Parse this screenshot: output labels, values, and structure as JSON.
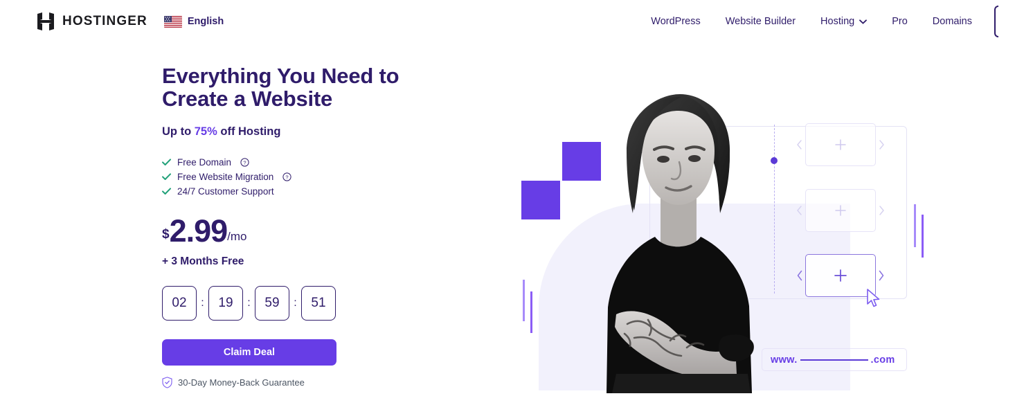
{
  "header": {
    "brand_name": "HOSTINGER",
    "logo_icon": "hostinger-h-logo",
    "language": {
      "label": "English",
      "flag_icon": "us-flag-icon"
    },
    "nav": [
      {
        "label": "WordPress",
        "has_chevron": false
      },
      {
        "label": "Website Builder",
        "has_chevron": false
      },
      {
        "label": "Hosting",
        "has_chevron": true
      },
      {
        "label": "Pro",
        "has_chevron": false
      },
      {
        "label": "Domains",
        "has_chevron": false
      }
    ]
  },
  "hero": {
    "headline_line1": "Everything You Need to",
    "headline_line2": "Create a Website",
    "subhead_prefix": "Up to ",
    "subhead_highlight": "75%",
    "subhead_suffix": " off Hosting",
    "features": [
      {
        "label": "Free Domain",
        "info": true
      },
      {
        "label": "Free Website Migration",
        "info": true
      },
      {
        "label": "24/7 Customer Support",
        "info": false
      }
    ],
    "price": {
      "currency": "$",
      "amount": "2.99",
      "period": "/mo"
    },
    "bonus": "+ 3 Months Free",
    "timer": {
      "separator": ":",
      "units": [
        "02",
        "19",
        "59",
        "51"
      ]
    },
    "cta_label": "Claim Deal",
    "guarantee": "30-Day Money-Back Guarantee",
    "guarantee_icon": "shield-check-icon"
  },
  "art": {
    "url_www": "www.",
    "url_tld": ".com",
    "card_icon": "plus-icon",
    "prev_icon": "chevron-left-icon",
    "next_icon": "chevron-right-icon",
    "cursor_icon": "mouse-pointer-icon"
  },
  "colors": {
    "brand_purple": "#673de6",
    "navy": "#2f1c6a",
    "check_green": "#21a179",
    "lavender_bg": "#f2f1fc"
  }
}
